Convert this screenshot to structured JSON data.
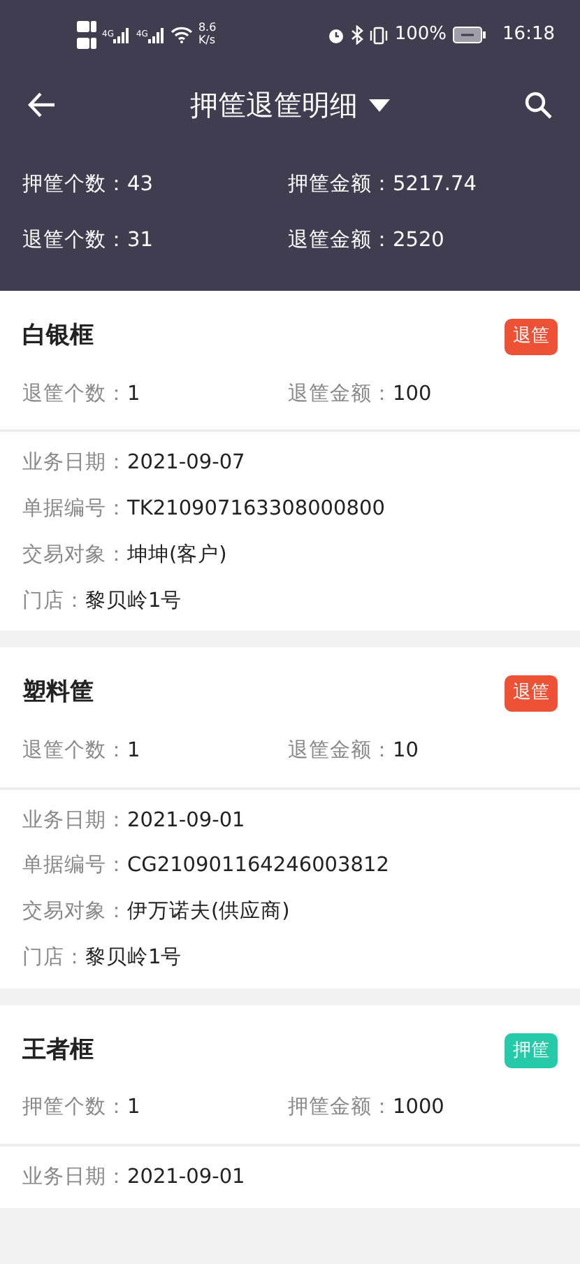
{
  "status_bar": {
    "network_1": "4G",
    "network_2": "4G",
    "speed_value": "8.6",
    "speed_unit": "K/s",
    "battery": "100%",
    "time": "16:18"
  },
  "header": {
    "title": "押筐退筐明细"
  },
  "summary": [
    {
      "label": "押筐个数：",
      "value": "43"
    },
    {
      "label": "押筐金额：",
      "value": "5217.74"
    },
    {
      "label": "退筐个数：",
      "value": "31"
    },
    {
      "label": "退筐金额：",
      "value": "2520"
    }
  ],
  "records": [
    {
      "name": "白银框",
      "tag": "退筐",
      "color": "#ee5236",
      "stats": [
        {
          "label": "退筐个数：",
          "value": "1"
        },
        {
          "label": "退筐金额：",
          "value": "100"
        }
      ],
      "details": [
        {
          "label": "业务日期：",
          "value": "2021-09-07"
        },
        {
          "label": "单据编号：",
          "value": "TK210907163308000800"
        },
        {
          "label": "交易对象：",
          "value": "坤坤(客户)"
        },
        {
          "label": "门店：",
          "value": "黎贝岭1号"
        }
      ]
    },
    {
      "name": "塑料筐",
      "tag": "退筐",
      "color": "#ee5236",
      "stats": [
        {
          "label": "退筐个数：",
          "value": "1"
        },
        {
          "label": "退筐金额：",
          "value": "10"
        }
      ],
      "details": [
        {
          "label": "业务日期：",
          "value": "2021-09-01"
        },
        {
          "label": "单据编号：",
          "value": "CG210901164246003812"
        },
        {
          "label": "交易对象：",
          "value": "伊万诺夫(供应商)"
        },
        {
          "label": "门店：",
          "value": "黎贝岭1号"
        }
      ]
    },
    {
      "name": "王者框",
      "tag": "押筐",
      "color": "#26c9a9",
      "stats": [
        {
          "label": "押筐个数：",
          "value": "1"
        },
        {
          "label": "押筐金额：",
          "value": "1000"
        }
      ],
      "details": [
        {
          "label": "业务日期：",
          "value": "2021-09-01"
        }
      ]
    }
  ]
}
